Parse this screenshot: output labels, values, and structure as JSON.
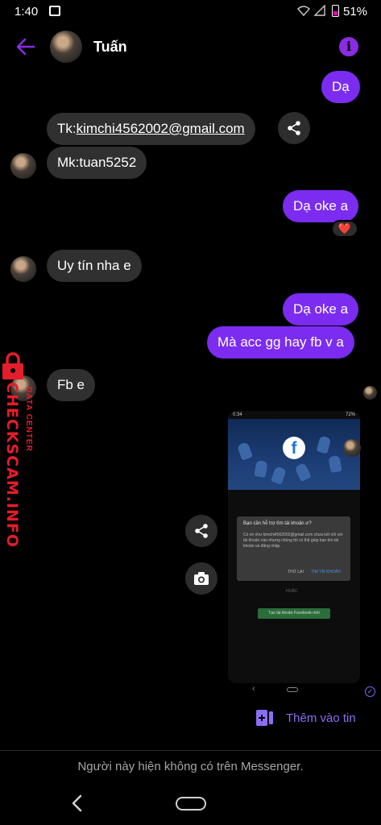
{
  "status_bar": {
    "time": "1:40",
    "battery": "51%"
  },
  "header": {
    "contact_name": "Tuấn"
  },
  "messages": [
    {
      "dir": "out",
      "text": "Dạ"
    },
    {
      "dir": "in",
      "prefix": "Tk:",
      "email": "kimchi4562002@gmail.com"
    },
    {
      "dir": "in",
      "text": "Mk:tuan5252"
    },
    {
      "dir": "out",
      "text": "Dạ oke a",
      "reaction": "❤️"
    },
    {
      "dir": "in",
      "text": "Uy tín nha e"
    },
    {
      "dir": "out",
      "text": "Dạ oke a"
    },
    {
      "dir": "out",
      "text": "Mà acc gg hay fb v a"
    },
    {
      "dir": "in",
      "text": "Fb e"
    }
  ],
  "watermark": {
    "main": "CHECKSCAM.INFO",
    "sub": "DATA CENTER"
  },
  "attachment": {
    "time": "0:34",
    "battery": "72%",
    "dialog_title": "Bạn cần hỗ trợ tìm tài khoản ư?",
    "dialog_body": "Có vẻ như kimchi4562002@gmail.com chưa kết nối với tài khoản nào nhưng chúng tôi có thể giúp bạn tìm tài khoản và đăng nhập.",
    "dialog_retry": "THỬ LẠI",
    "dialog_find": "TÌM TÀI KHOẢN",
    "divider_text": "HOẶC",
    "create_account": "Tạo tài khoản Facebook mới"
  },
  "add_to_story": "Thêm vào tin",
  "footer": {
    "unavailable": "Người này hiện không có trên Messenger."
  },
  "colors": {
    "accent": "#7b2cf0",
    "incoming": "#303030",
    "watermark": "#e51d2a"
  }
}
